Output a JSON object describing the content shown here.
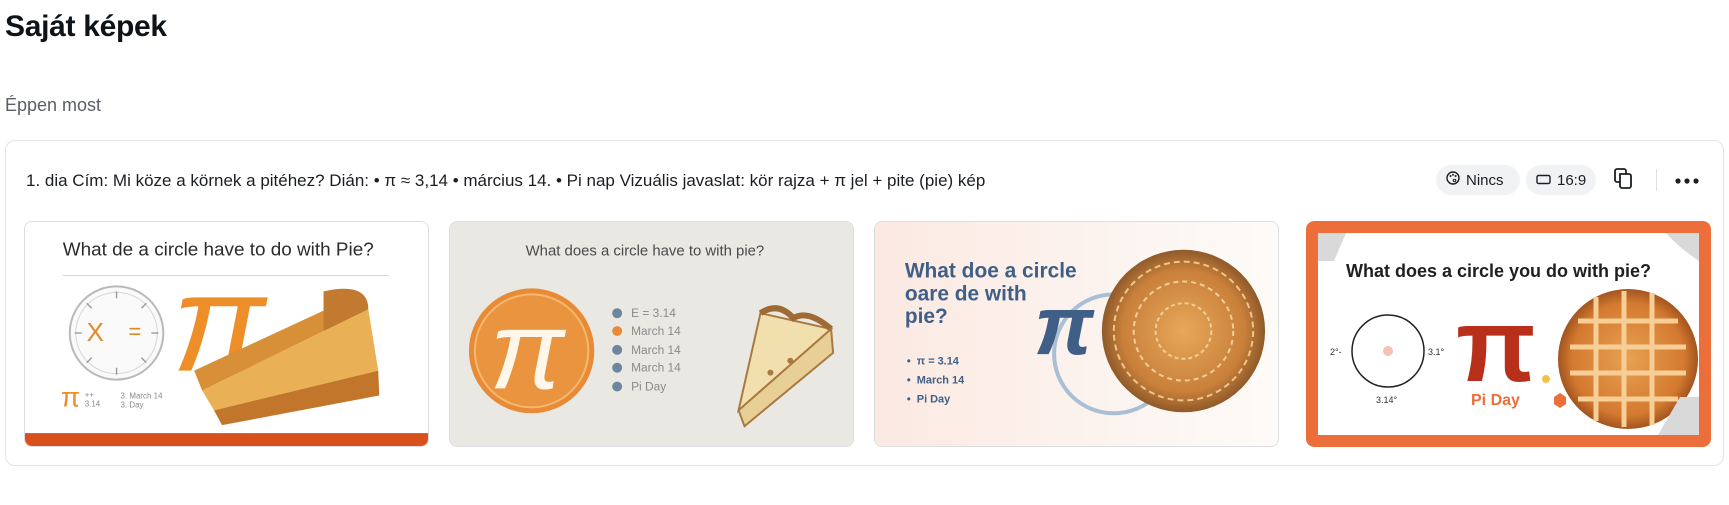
{
  "page": {
    "title": "Saját képek",
    "section": "Éppen most"
  },
  "card": {
    "prompt": "1. dia Cím: Mi köze a körnek a pitéhez? Dián: • π ≈ 3,14 • március 14. • Pi nap Vizuális javaslat: kör rajza + π jel + pite (pie) kép",
    "style_chip": {
      "icon": "palette-icon",
      "label": "Nincs"
    },
    "ratio_chip": {
      "icon": "rectangle-icon",
      "label": "16:9"
    },
    "copy_icon": "copy-icon",
    "more_icon": "more-horizontal-icon"
  },
  "images": [
    {
      "title": "What de a circle have to do with Pie?",
      "pi": "π",
      "small": [
        "++",
        "3.14"
      ],
      "notes": [
        "3. March 14",
        "3. Day"
      ],
      "clock_x": "X",
      "clock_eq": "="
    },
    {
      "title": "What does a circle have to with pie?",
      "pi": "π",
      "bullets": [
        "E = 3.14",
        "March 14",
        "March 14",
        "March 14",
        "Pi Day"
      ]
    },
    {
      "title_lines": [
        "What doe a circle",
        "oare de with",
        "pie?"
      ],
      "pi": "π",
      "bullets": [
        "π = 3.14",
        "March 14",
        "Pi Day"
      ]
    },
    {
      "title": "What does a circle you do with pie?",
      "pi": "π",
      "labels": [
        "2°-",
        "3.1°",
        "3.14°"
      ],
      "caption": "Pi Day"
    }
  ],
  "colors": {
    "accent_orange": "#e8772e",
    "slate_blue": "#3f5f86",
    "frame_orange": "#ec6e3a"
  }
}
